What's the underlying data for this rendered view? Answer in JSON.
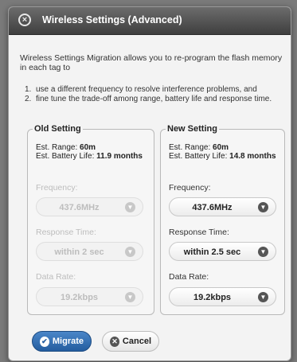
{
  "dialog": {
    "title": "Wireless Settings (Advanced)",
    "intro": "Wireless Settings Migration allows you to re-program the flash memory in each tag to",
    "list": [
      {
        "num": "1.",
        "text": "use a different frequency to resolve interference problems, and"
      },
      {
        "num": "2.",
        "text": "fine tune the trade-off among range, battery life and response time."
      }
    ]
  },
  "old_setting": {
    "legend": "Old Setting",
    "range_label": "Est. Range:",
    "range_value": "60m",
    "battery_label": "Est. Battery Life:",
    "battery_value": "11.9 months",
    "frequency_label": "Frequency:",
    "frequency_value": "437.6MHz",
    "response_label": "Response Time:",
    "response_value": "within 2 sec",
    "datarate_label": "Data Rate:",
    "datarate_value": "19.2kbps"
  },
  "new_setting": {
    "legend": "New Setting",
    "range_label": "Est. Range:",
    "range_value": "60m",
    "battery_label": "Est. Battery Life:",
    "battery_value": "14.8 months",
    "frequency_label": "Frequency:",
    "frequency_value": "437.6MHz",
    "response_label": "Response Time:",
    "response_value": "within 2.5 sec",
    "datarate_label": "Data Rate:",
    "datarate_value": "19.2kbps"
  },
  "buttons": {
    "migrate": "Migrate",
    "cancel": "Cancel"
  },
  "icons": {
    "close": "close-icon",
    "check": "check-icon",
    "cancel": "close-icon",
    "dropdown": "chevron-down-icon"
  },
  "colors": {
    "titlebar": "#4a4a4a",
    "primary": "#2f6db3",
    "disabled_text": "#bdbdbd"
  }
}
